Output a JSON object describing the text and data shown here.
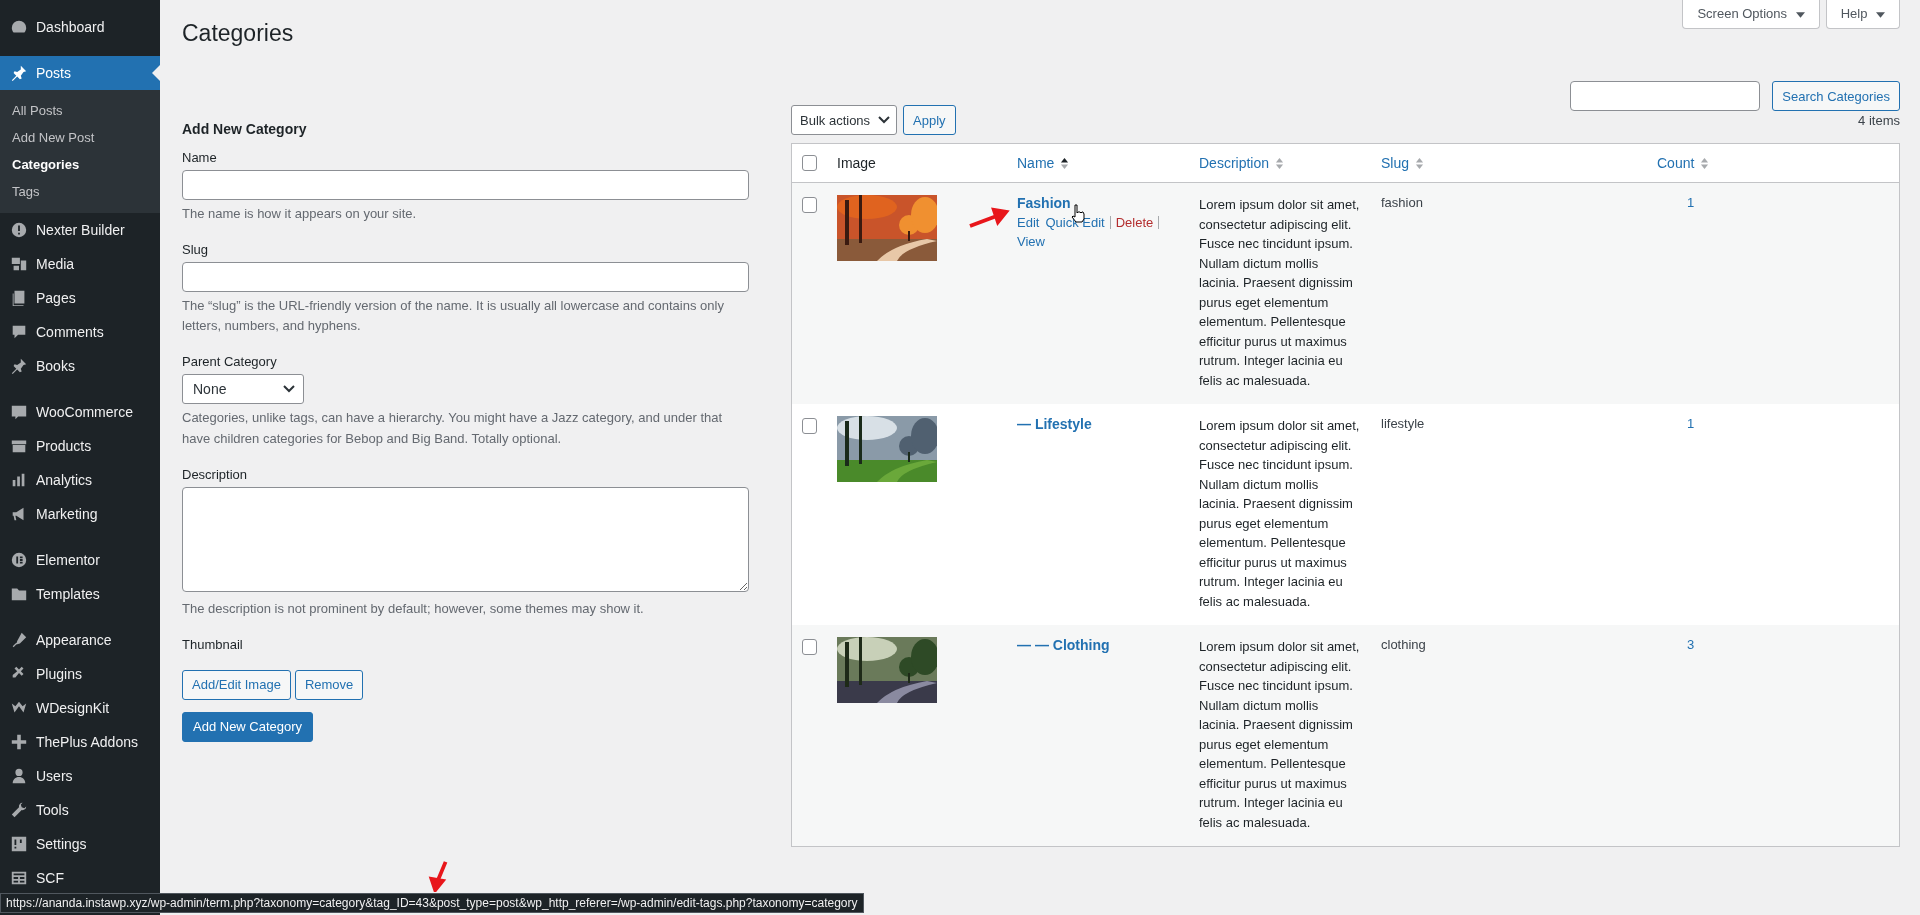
{
  "sidebar": {
    "groups": [
      [
        {
          "label": "Dashboard",
          "selected": false
        }
      ],
      [
        {
          "label": "Posts",
          "selected": true,
          "submenu": [
            {
              "label": "All Posts",
              "selected": false
            },
            {
              "label": "Add New Post",
              "selected": false
            },
            {
              "label": "Categories",
              "selected": true
            },
            {
              "label": "Tags",
              "selected": false
            }
          ]
        },
        {
          "label": "Nexter Builder",
          "selected": false
        },
        {
          "label": "Media",
          "selected": false
        },
        {
          "label": "Pages",
          "selected": false
        },
        {
          "label": "Comments",
          "selected": false
        },
        {
          "label": "Books",
          "selected": false
        }
      ],
      [
        {
          "label": "WooCommerce",
          "selected": false
        },
        {
          "label": "Products",
          "selected": false
        },
        {
          "label": "Analytics",
          "selected": false
        },
        {
          "label": "Marketing",
          "selected": false
        }
      ],
      [
        {
          "label": "Elementor",
          "selected": false
        },
        {
          "label": "Templates",
          "selected": false
        }
      ],
      [
        {
          "label": "Appearance",
          "selected": false
        },
        {
          "label": "Plugins",
          "selected": false
        },
        {
          "label": "WDesignKit",
          "selected": false
        },
        {
          "label": "ThePlus Addons",
          "selected": false
        },
        {
          "label": "Users",
          "selected": false
        },
        {
          "label": "Tools",
          "selected": false
        },
        {
          "label": "Settings",
          "selected": false
        },
        {
          "label": "SCF",
          "selected": false
        }
      ]
    ]
  },
  "header": {
    "title": "Categories",
    "tabs": [
      "Screen Options",
      "Help"
    ]
  },
  "search": {
    "button": "Search Categories"
  },
  "form": {
    "heading": "Add New Category",
    "fields": [
      {
        "kind": "text",
        "label": "Name",
        "help": "The name is how it appears on your site."
      },
      {
        "kind": "text",
        "label": "Slug",
        "help": "The “slug” is the URL-friendly version of the name. It is usually all lowercase and contains only letters, numbers, and hyphens."
      },
      {
        "kind": "select",
        "label": "Parent Category",
        "value": "None",
        "help": "Categories, unlike tags, can have a hierarchy. You might have a Jazz category, and under that have children categories for Bebop and Big Band. Totally optional."
      },
      {
        "kind": "textarea",
        "label": "Description",
        "help": "The description is not prominent by default; however, some themes may show it."
      },
      {
        "label": "Thumbnail",
        "buttons": [
          "Add/Edit Image",
          "Remove"
        ]
      }
    ],
    "submit": "Add New Category"
  },
  "table": {
    "bulk_actions": "Bulk actions",
    "apply": "Apply",
    "count": "4 items",
    "select_all_checked": false,
    "columns": [
      {
        "label": "Image",
        "sortable": false,
        "sorted": false
      },
      {
        "label": "Name",
        "sortable": true,
        "sorted": true
      },
      {
        "label": "Description",
        "sortable": true,
        "sorted": false
      },
      {
        "label": "Slug",
        "sortable": true,
        "sorted": false
      },
      {
        "label": "Count",
        "sortable": true,
        "sorted": false
      }
    ],
    "rows": [
      {
        "checked": false,
        "image": {
          "kind": "picture"
        },
        "name": "Fashion",
        "actions": [
          {
            "label": "Edit",
            "kind": "normal"
          },
          {
            "label": "Quick Edit",
            "kind": "normal"
          },
          {
            "label": "Delete",
            "kind": "danger"
          },
          {
            "label": "View",
            "kind": "normal"
          }
        ],
        "description": "Lorem ipsum dolor sit amet, consectetur adipiscing elit. Fusce nec tincidunt ipsum. Nullam dictum mollis lacinia. Praesent dignissim purus eget elementum elementum. Pellentesque efficitur purus ut maximus rutrum. Integer lacinia eu felis ac malesuada.",
        "slug": "fashion",
        "count": "1"
      },
      {
        "checked": false,
        "image": {
          "kind": "picture"
        },
        "name": "— Lifestyle",
        "description": "Lorem ipsum dolor sit amet, consectetur adipiscing elit. Fusce nec tincidunt ipsum. Nullam dictum mollis lacinia. Praesent dignissim purus eget elementum elementum. Pellentesque efficitur purus ut maximus rutrum. Integer lacinia eu felis ac malesuada.",
        "slug": "lifestyle",
        "count": "1"
      },
      {
        "checked": false,
        "image": {
          "kind": "picture"
        },
        "name": "— — Clothing",
        "description": "Lorem ipsum dolor sit amet, consectetur adipiscing elit. Fusce nec tincidunt ipsum. Nullam dictum mollis lacinia. Praesent dignissim purus eget elementum elementum. Pellentesque efficitur purus ut maximus rutrum. Integer lacinia eu felis ac malesuada.",
        "slug": "clothing",
        "count": "3"
      }
    ]
  },
  "status_url": "https://ananda.instawp.xyz/wp-admin/term.php?taxonomy=category&tag_ID=43&post_type=post&wp_http_referer=/wp-admin/edit-tags.php?taxonomy=category"
}
